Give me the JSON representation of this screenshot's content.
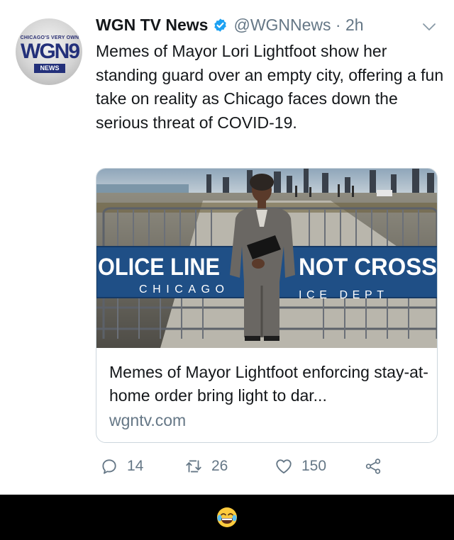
{
  "avatar": {
    "tagline": "CHICAGO'S VERY OWN",
    "logo": "WGN9",
    "badge": "NEWS"
  },
  "tweet": {
    "author_name": "WGN TV News",
    "verified_icon": "verified-badge-icon",
    "handle_time": "@WGNNews · 2h",
    "menu_icon": "chevron-down-icon",
    "text": "Memes of Mayor Lori Lightfoot show her standing guard over an empty city, offering a fun take on reality as Chicago faces down the serious threat of COVID-19."
  },
  "card": {
    "photo": {
      "barrier_left_main": "OLICE LINE",
      "barrier_left_sub": "CHICAGO",
      "barrier_right_main": "NOT CROSS",
      "barrier_right_sub": "ICE DEPT"
    },
    "title": "Memes of Mayor Lightfoot enforcing stay-at-home order bring light to dar...",
    "domain": "wgntv.com"
  },
  "actions": {
    "reply_count": "14",
    "retweet_count": "26",
    "like_count": "150",
    "share_icon": "share-icon"
  },
  "colors": {
    "accent": "#1da1f2",
    "secondary_text": "#657786",
    "border": "#ccd6dd",
    "barrier_blue": "#1f4f86"
  },
  "footer": {
    "emoji": "face-with-tears-of-joy"
  }
}
